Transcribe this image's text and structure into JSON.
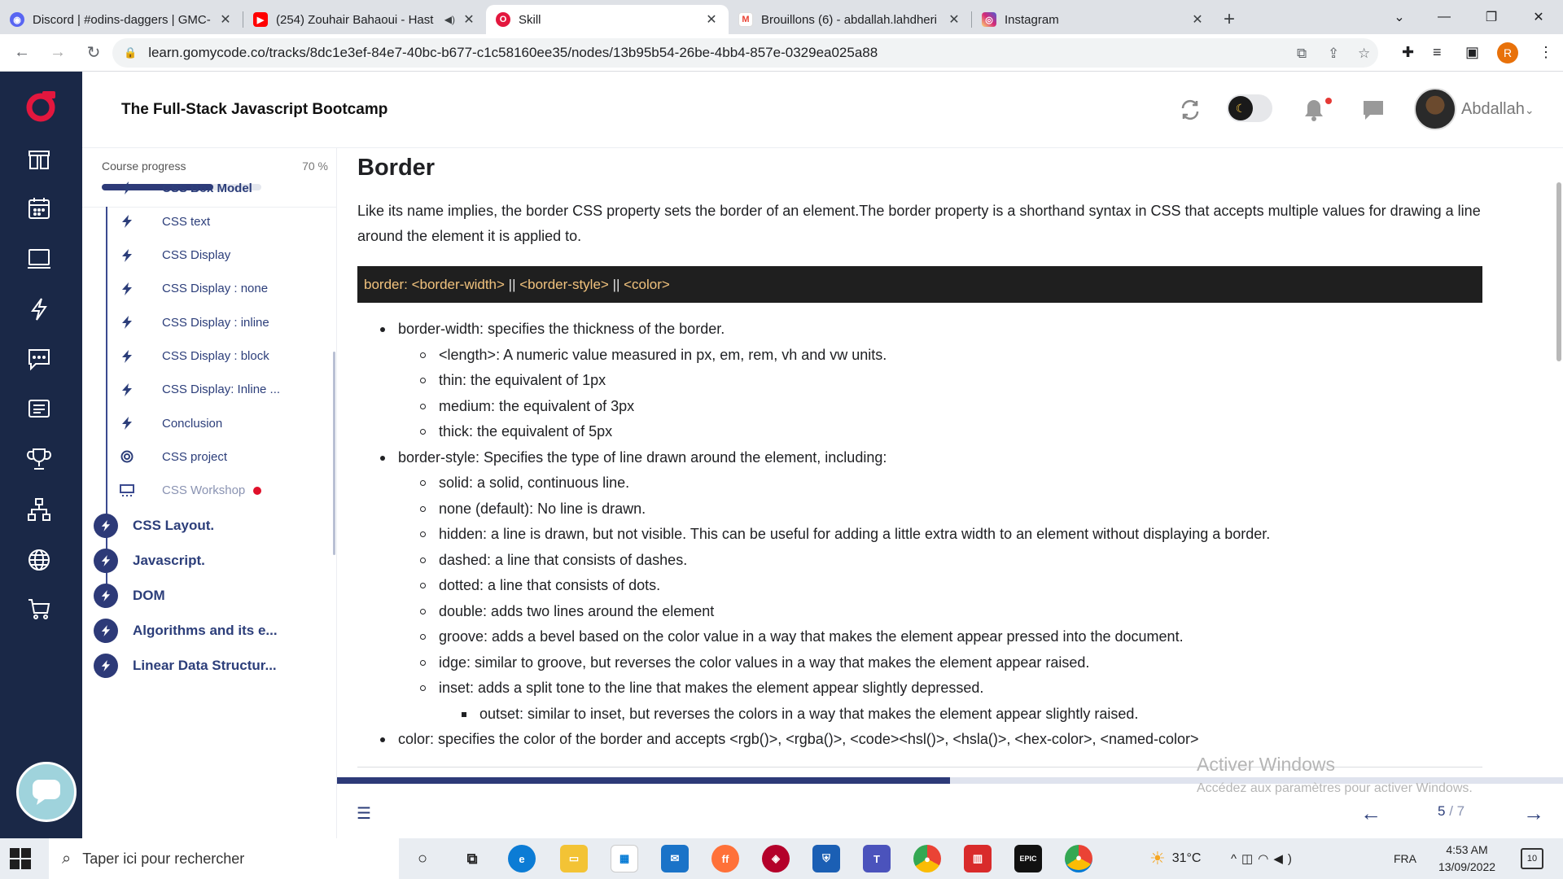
{
  "browser": {
    "tabs": [
      {
        "title": "Discord | #odins-daggers | GMC-",
        "icon": "discord-icon",
        "color": "#5865f2"
      },
      {
        "title": "(254) Zouhair Bahaoui - Hast",
        "icon": "youtube-icon",
        "color": "#ff0000"
      },
      {
        "title": "Skill",
        "icon": "gomycode-icon",
        "color": "#e3173e"
      },
      {
        "title": "Brouillons (6) - abdallah.lahdheri",
        "icon": "gmail-icon",
        "color": "#ea4335"
      },
      {
        "title": "Instagram",
        "icon": "instagram-icon",
        "color": "#d62976"
      }
    ],
    "url": "learn.gomycode.co/tracks/8dc1e3ef-84e7-40bc-b677-c1c58160ee35/nodes/13b95b54-26be-4bb4-857e-0329ea025a88",
    "profile_initial": "R"
  },
  "header": {
    "course_title": "The Full-Stack Javascript Bootcamp",
    "username": "Abdallah"
  },
  "sidebar": {
    "progress_label": "Course progress",
    "progress_text": "70 %",
    "progress_value": 70,
    "sub_items": [
      {
        "label": "CSS Box Model",
        "icon": "bolt-icon",
        "active": true
      },
      {
        "label": "CSS text",
        "icon": "bolt-icon"
      },
      {
        "label": "CSS Display",
        "icon": "bolt-icon"
      },
      {
        "label": "CSS Display : none",
        "icon": "bolt-icon"
      },
      {
        "label": "CSS Display : inline",
        "icon": "bolt-icon"
      },
      {
        "label": "CSS Display : block",
        "icon": "bolt-icon"
      },
      {
        "label": "CSS Display: Inline ...",
        "icon": "bolt-icon"
      },
      {
        "label": "Conclusion",
        "icon": "bolt-icon"
      },
      {
        "label": "CSS project",
        "icon": "target-icon"
      },
      {
        "label": "CSS Workshop",
        "icon": "workshop-icon",
        "dim": true,
        "dot": true
      }
    ],
    "sections": [
      {
        "label": "CSS Layout."
      },
      {
        "label": "Javascript."
      },
      {
        "label": "DOM"
      },
      {
        "label": "Algorithms and its e..."
      },
      {
        "label": "Linear Data Structur..."
      }
    ]
  },
  "lesson": {
    "title": "Border",
    "intro": "Like its name implies, the border CSS property sets the border of an element.The border property is a shorthand syntax in CSS that accepts multiple values for drawing a line around the element it is applied to.",
    "code": {
      "prefix": "border: ",
      "width": "<border-width>",
      "sep1": " || ",
      "style": "<border-style>",
      "sep2": " || ",
      "color": "<color>"
    },
    "bullets": [
      {
        "level": 1,
        "text": "border-width: specifies the thickness of the border."
      },
      {
        "level": 2,
        "text": "<length>: A numeric value measured in px, em, rem, vh and vw units."
      },
      {
        "level": 2,
        "text": "thin: the equivalent of 1px"
      },
      {
        "level": 2,
        "text": "medium: the equivalent of 3px"
      },
      {
        "level": 2,
        "text": "thick: the equivalent of 5px"
      },
      {
        "level": 1,
        "text": "border-style: Specifies the type of line drawn around the element, including:"
      },
      {
        "level": 2,
        "text": "solid: a solid, continuous line."
      },
      {
        "level": 2,
        "text": "none (default): No line is drawn."
      },
      {
        "level": 2,
        "text": "hidden: a line is drawn, but not visible. This can be useful for adding a little extra width to an element without displaying a border."
      },
      {
        "level": 2,
        "text": "dashed: a line that consists of dashes."
      },
      {
        "level": 2,
        "text": "dotted: a line that consists of dots."
      },
      {
        "level": 2,
        "text": "double: adds two lines around the element"
      },
      {
        "level": 2,
        "text": "groove: adds a bevel based on the color value in a way that makes the element appear pressed into the document."
      },
      {
        "level": 2,
        "text": "idge: similar to groove, but reverses the color values in a way that makes the element appear raised."
      },
      {
        "level": 2,
        "text": "inset: adds a split tone to the line that makes the element appear slightly depressed."
      },
      {
        "level": 3,
        "text": "outset: similar to inset, but reverses the colors in a way that makes the element appear slightly raised."
      },
      {
        "level": 1,
        "text": "color: specifies the color of the border and accepts <rgb()>, <rgba()>, <code><hsl()>, <hsla()>, <hex-color>, <named-color>"
      }
    ]
  },
  "nav": {
    "current_page": "5",
    "separator": " / ",
    "total_pages": "7",
    "lesson_progress": 0.5
  },
  "watermark": {
    "line1": "Activer Windows",
    "line2": "Accédez aux paramètres pour activer Windows."
  },
  "taskbar": {
    "search_placeholder": "Taper ici pour rechercher",
    "temperature": "31°C",
    "language": "FRA",
    "time": "4:53 AM",
    "date": "13/09/2022",
    "notifications": "10"
  },
  "colors": {
    "rail": "#1a2847",
    "accent": "#2d3a78",
    "brand": "#e3173e"
  }
}
